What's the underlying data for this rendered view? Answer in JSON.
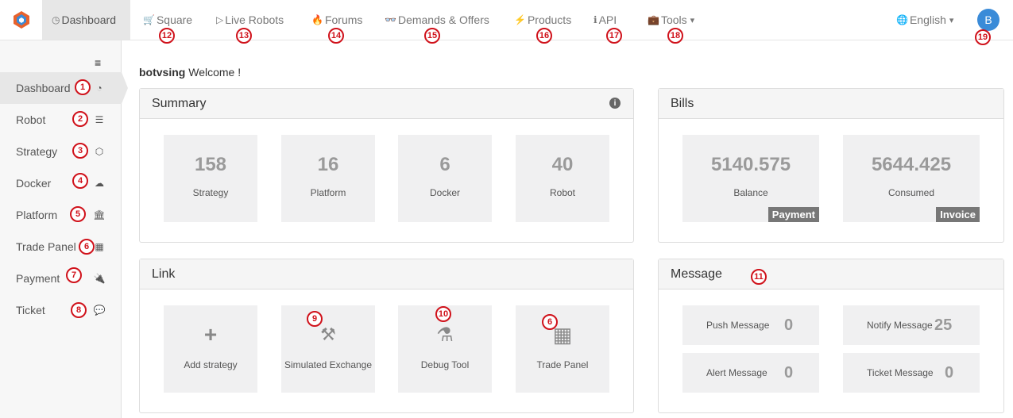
{
  "colors": {
    "accent": "#3a8bd8",
    "badge": "#d0121b",
    "tile_bg": "#f0f0f1",
    "tag_bg": "#777777"
  },
  "topnav": {
    "items": [
      {
        "label": "Dashboard",
        "icon": "dashboard-icon",
        "glyph": "◷"
      },
      {
        "label": "Square",
        "icon": "cart-icon",
        "glyph": "🛒"
      },
      {
        "label": "Live Robots",
        "icon": "play-circle-icon",
        "glyph": "▷"
      },
      {
        "label": "Forums",
        "icon": "fire-icon",
        "glyph": "🔥"
      },
      {
        "label": "Demands & Offers",
        "icon": "glasses-icon",
        "glyph": "👓"
      },
      {
        "label": "Products",
        "icon": "bolt-icon",
        "glyph": "⚡"
      },
      {
        "label": "API",
        "icon": "info-circle-icon",
        "glyph": "ℹ"
      },
      {
        "label": "Tools",
        "icon": "briefcase-icon",
        "glyph": "💼",
        "caret": "▾"
      }
    ],
    "language": "English",
    "language_caret": "▾",
    "avatar_letter": "B"
  },
  "badges": [
    "1",
    "2",
    "3",
    "4",
    "5",
    "6",
    "7",
    "8",
    "9",
    "10",
    "11",
    "6",
    "12",
    "13",
    "14",
    "15",
    "16",
    "17",
    "18",
    "19"
  ],
  "sidebar": {
    "toggle": "≡",
    "items": [
      {
        "label": "Dashboard",
        "icon": "tachometer-icon",
        "glyph": "◔"
      },
      {
        "label": "Robot",
        "icon": "list-icon",
        "glyph": "☰"
      },
      {
        "label": "Strategy",
        "icon": "cube-icon",
        "glyph": "⬡"
      },
      {
        "label": "Docker",
        "icon": "cloud-icon",
        "glyph": "☁"
      },
      {
        "label": "Platform",
        "icon": "bank-icon",
        "glyph": "🏛"
      },
      {
        "label": "Trade Panel",
        "icon": "calculator-icon",
        "glyph": "▦"
      },
      {
        "label": "Payment",
        "icon": "plug-icon",
        "glyph": "🔌"
      },
      {
        "label": "Ticket",
        "icon": "comment-icon",
        "glyph": "💬"
      }
    ]
  },
  "welcome": {
    "user": "botvsing",
    "text": " Welcome !"
  },
  "summary": {
    "title": "Summary",
    "info_glyph": "i",
    "tiles": [
      {
        "value": "158",
        "label": "Strategy"
      },
      {
        "value": "16",
        "label": "Platform"
      },
      {
        "value": "6",
        "label": "Docker"
      },
      {
        "value": "40",
        "label": "Robot"
      }
    ]
  },
  "bills": {
    "title": "Bills",
    "tiles": [
      {
        "value": "5140.575",
        "label": "Balance",
        "tag": "Payment"
      },
      {
        "value": "5644.425",
        "label": "Consumed",
        "tag": "Invoice"
      }
    ]
  },
  "link": {
    "title": "Link",
    "tiles": [
      {
        "label": "Add strategy",
        "icon": "plus-icon",
        "glyph": "+"
      },
      {
        "label": "Simulated Exchange",
        "icon": "magic-wand-icon",
        "glyph": "⚒"
      },
      {
        "label": "Debug Tool",
        "icon": "flask-icon",
        "glyph": "⚗"
      },
      {
        "label": "Trade Panel",
        "icon": "calculator-icon",
        "glyph": "▦"
      }
    ]
  },
  "message": {
    "title": "Message",
    "items": [
      {
        "label": "Push Message",
        "value": "0"
      },
      {
        "label": "Notify Message",
        "value": "25"
      },
      {
        "label": "Alert Message",
        "value": "0"
      },
      {
        "label": "Ticket Message",
        "value": "0"
      }
    ]
  }
}
